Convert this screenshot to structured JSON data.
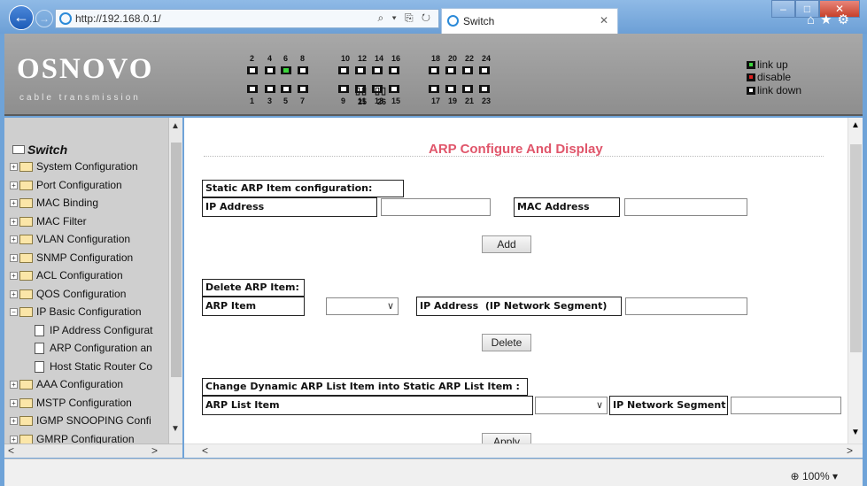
{
  "browser": {
    "url": "http://192.168.0.1/",
    "tab_title": "Switch",
    "zoom": "100%"
  },
  "header": {
    "logo": "OSNOVO",
    "logo_sub": "cable transmission",
    "port_numbers_top": [
      "2",
      "4",
      "6",
      "8",
      "10",
      "12",
      "14",
      "16",
      "18",
      "20",
      "22",
      "24"
    ],
    "port_numbers_bottom": [
      "1",
      "3",
      "5",
      "7",
      "9",
      "11",
      "13",
      "15",
      "17",
      "19",
      "21",
      "23"
    ],
    "sfp_labels": [
      "25",
      "26"
    ],
    "legend": [
      "link up",
      "disable",
      "link down"
    ],
    "link_up_ports": [
      "6"
    ],
    "colors": {
      "link_up": "#3cd43c",
      "disable": "#e02020",
      "link_down": "#ffffff"
    }
  },
  "sidebar": {
    "root": "Switch",
    "items": [
      "System Configuration",
      "Port Configuration",
      "MAC Binding",
      "MAC Filter",
      "VLAN Configuration",
      "SNMP Configuration",
      "ACL Configuration",
      "QOS Configuration",
      "IP Basic Configuration"
    ],
    "subitems": [
      "IP Address Configurat",
      "ARP Configuration an",
      "Host Static Router Co"
    ],
    "items_after": [
      "AAA Configuration",
      "MSTP Configuration",
      "IGMP SNOOPING Confi",
      "GMRP Configuration"
    ]
  },
  "main": {
    "title": "ARP Configure And Display",
    "title_color": "#e0566b",
    "static": {
      "heading": "Static ARP Item configuration:",
      "ip_label": "IP Address",
      "mac_label": "MAC Address",
      "add_button": "Add"
    },
    "delete": {
      "heading": "Delete ARP Item:",
      "arp_label": "ARP Item",
      "ip_label": "IP Address  (IP Network Segment)",
      "delete_button": "Delete"
    },
    "change": {
      "heading": "Change Dynamic ARP List Item into Static ARP List Item :",
      "list_label": "ARP List Item",
      "segment_label": "IP Network Segment",
      "apply_button": "Apply"
    }
  }
}
